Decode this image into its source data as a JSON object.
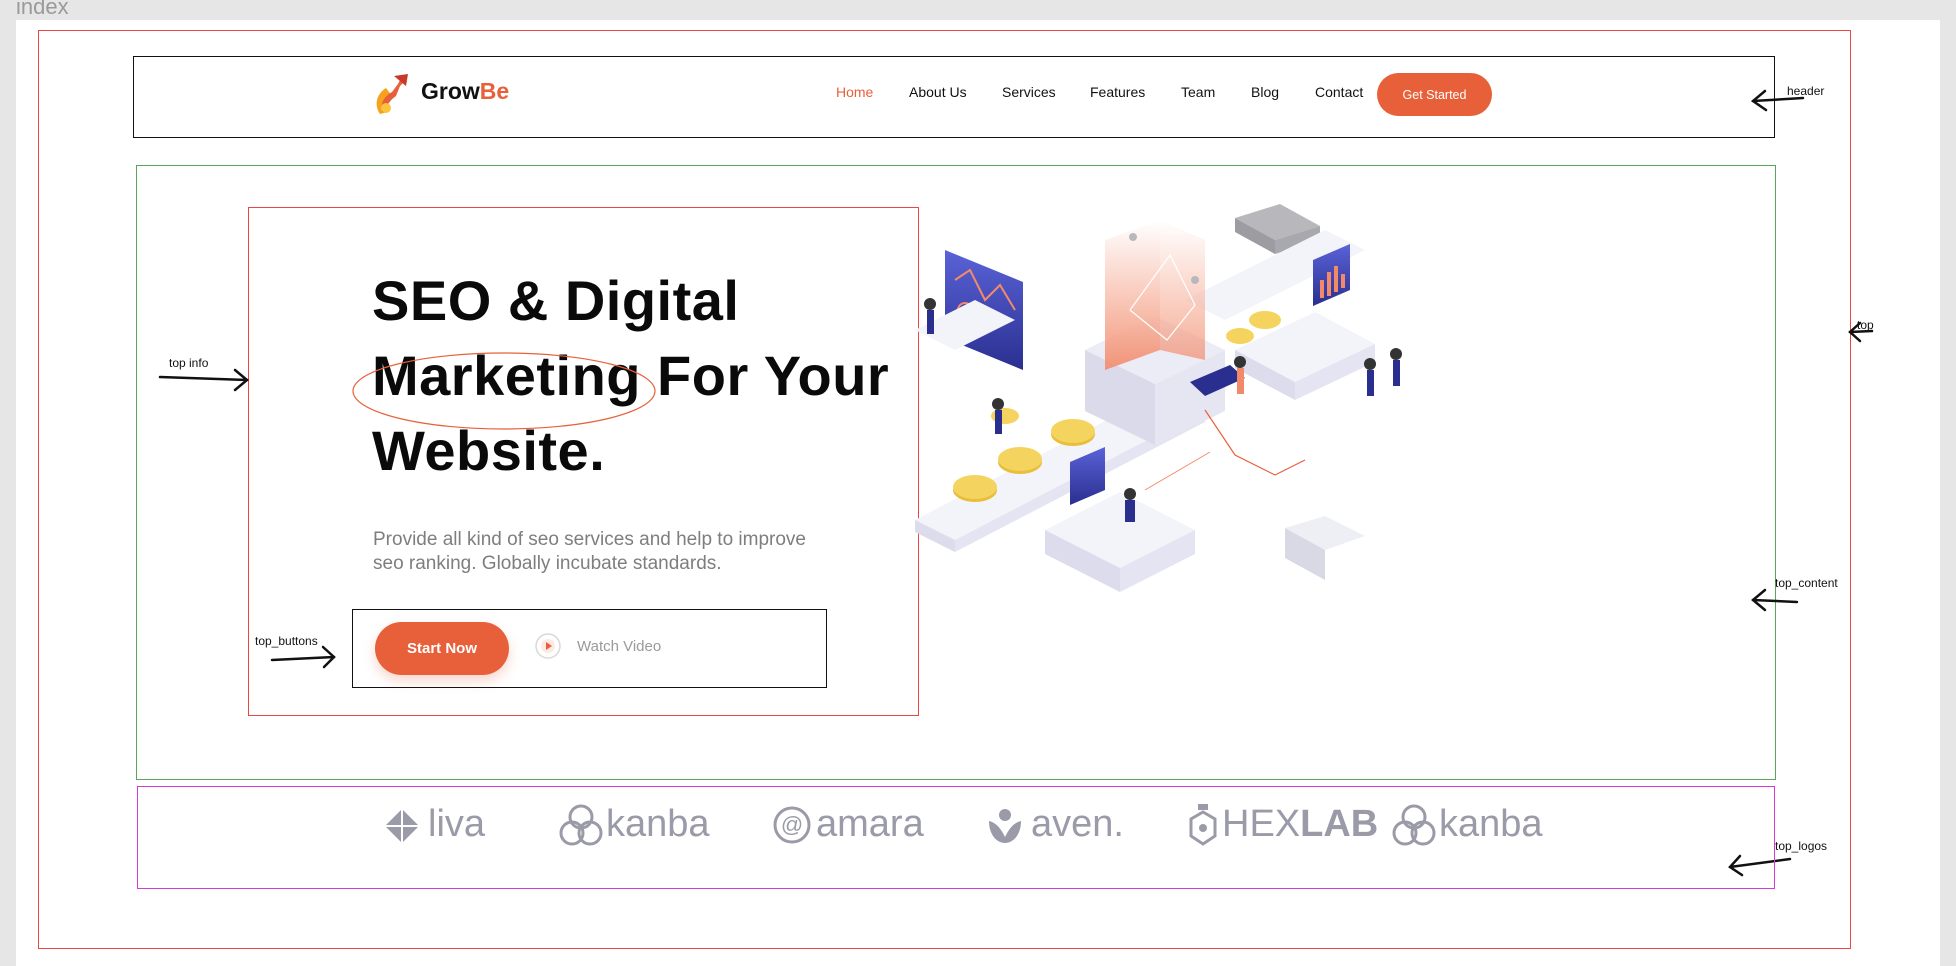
{
  "frame": {
    "title": "index"
  },
  "annotations": {
    "header": "header",
    "top": "top",
    "top_info": "top info",
    "top_buttons": "top_buttons",
    "top_content": "top_content",
    "top_logos": "top_logos"
  },
  "header": {
    "brand_main": "Grow",
    "brand_accent": "Be",
    "nav": [
      "Home",
      "About Us",
      "Services",
      "Features",
      "Team",
      "Blog",
      "Contact"
    ],
    "active_nav": "Home",
    "cta": "Get Started"
  },
  "hero": {
    "title_lines": [
      "SEO & Digital",
      "Marketing For Your",
      "Website."
    ],
    "subtitle_lines": [
      "Provide all kind of seo services and help to improve",
      "seo ranking. Globally incubate standards."
    ],
    "primary_button": "Start Now",
    "secondary_button": "Watch Video"
  },
  "logos": [
    "liva",
    "kanba",
    "amara",
    "aven.",
    "HEX",
    "LAB",
    "kanba"
  ],
  "colors": {
    "accent": "#e8603a",
    "text": "#0a0a0a",
    "muted": "#7e7e7e",
    "logo_gray": "#9a9aa8",
    "annotation_red": "#ee4444",
    "annotation_green": "#5aa55a",
    "annotation_magenta": "#d63ad6"
  }
}
